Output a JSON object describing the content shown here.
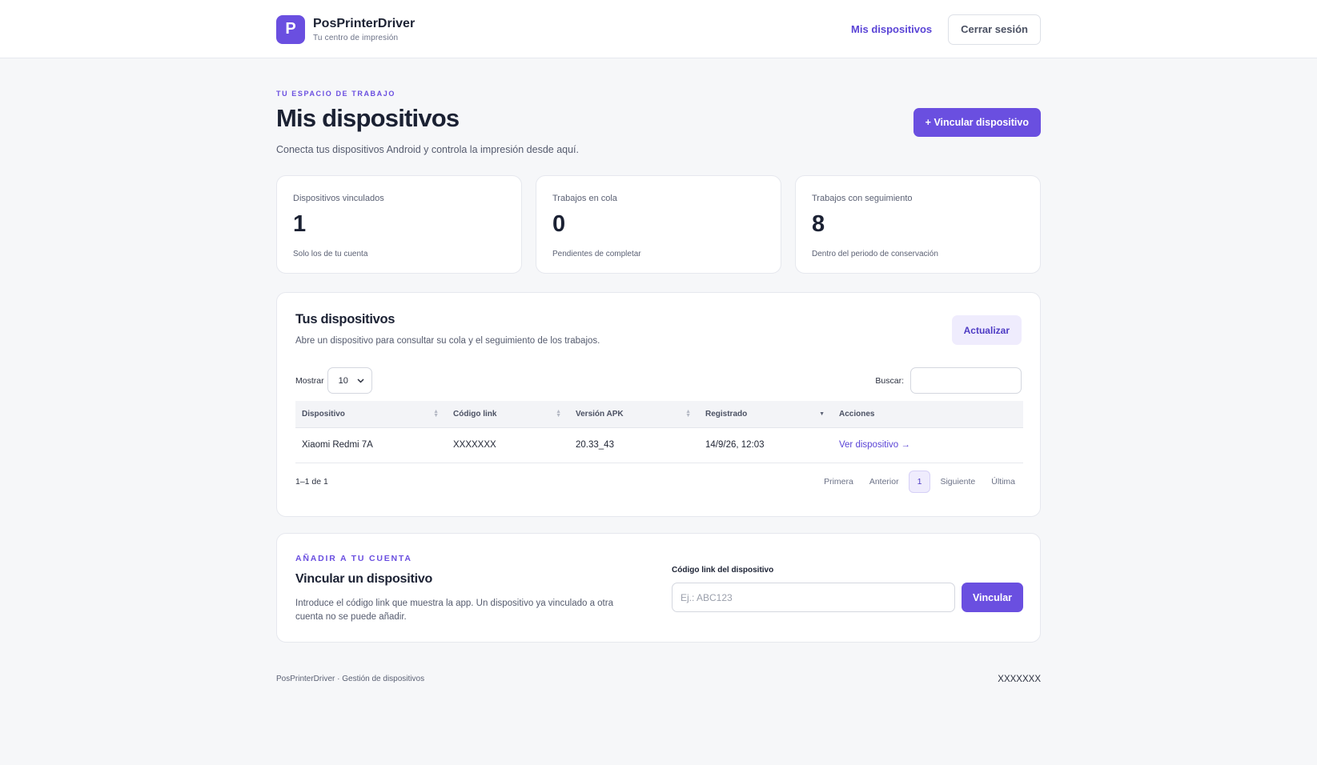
{
  "header": {
    "logo_letter": "P",
    "brand_name": "PosPrinterDriver",
    "brand_tagline": "Tu centro de impresión",
    "nav_link": "Mis dispositivos",
    "logout_label": "Cerrar sesión"
  },
  "hero": {
    "eyebrow": "TU ESPACIO DE TRABAJO",
    "title": "Mis dispositivos",
    "description": "Conecta tus dispositivos Android y controla la impresión desde aquí.",
    "link_button": "+ Vincular dispositivo"
  },
  "stats": [
    {
      "label": "Dispositivos vinculados",
      "value": "1",
      "hint": "Solo los de tu cuenta"
    },
    {
      "label": "Trabajos en cola",
      "value": "0",
      "hint": "Pendientes de completar"
    },
    {
      "label": "Trabajos con seguimiento",
      "value": "8",
      "hint": "Dentro del periodo de conservación"
    }
  ],
  "devices": {
    "title": "Tus dispositivos",
    "description": "Abre un dispositivo para consultar su cola y el seguimiento de los trabajos.",
    "refresh_label": "Actualizar",
    "show_label": "Mostrar",
    "page_size": "10",
    "search_label": "Buscar:",
    "columns": [
      "Dispositivo",
      "Código link",
      "Versión APK",
      "Registrado",
      "Acciones"
    ],
    "rows": [
      {
        "device": "Xiaomi Redmi 7A",
        "code": "XXXXXXX",
        "apk": "20.33_43",
        "registered": "14/9/26, 12:03",
        "action": "Ver dispositivo →"
      }
    ],
    "count_text": "1–1 de 1",
    "pager": {
      "first": "Primera",
      "prev": "Anterior",
      "current": "1",
      "next": "Siguiente",
      "last": "Última"
    }
  },
  "link_card": {
    "eyebrow": "AÑADIR A TU CUENTA",
    "title": "Vincular un dispositivo",
    "description": "Introduce el código link que muestra la app. Un dispositivo ya vinculado a otra cuenta no se puede añadir.",
    "field_label": "Código link del dispositivo",
    "placeholder": "Ej.: ABC123",
    "submit_label": "Vincular"
  },
  "footer": {
    "left": "PosPrinterDriver · Gestión de dispositivos",
    "right": "XXXXXXX"
  },
  "colors": {
    "accent": "#6a4fe0",
    "background": "#f6f7f9"
  }
}
